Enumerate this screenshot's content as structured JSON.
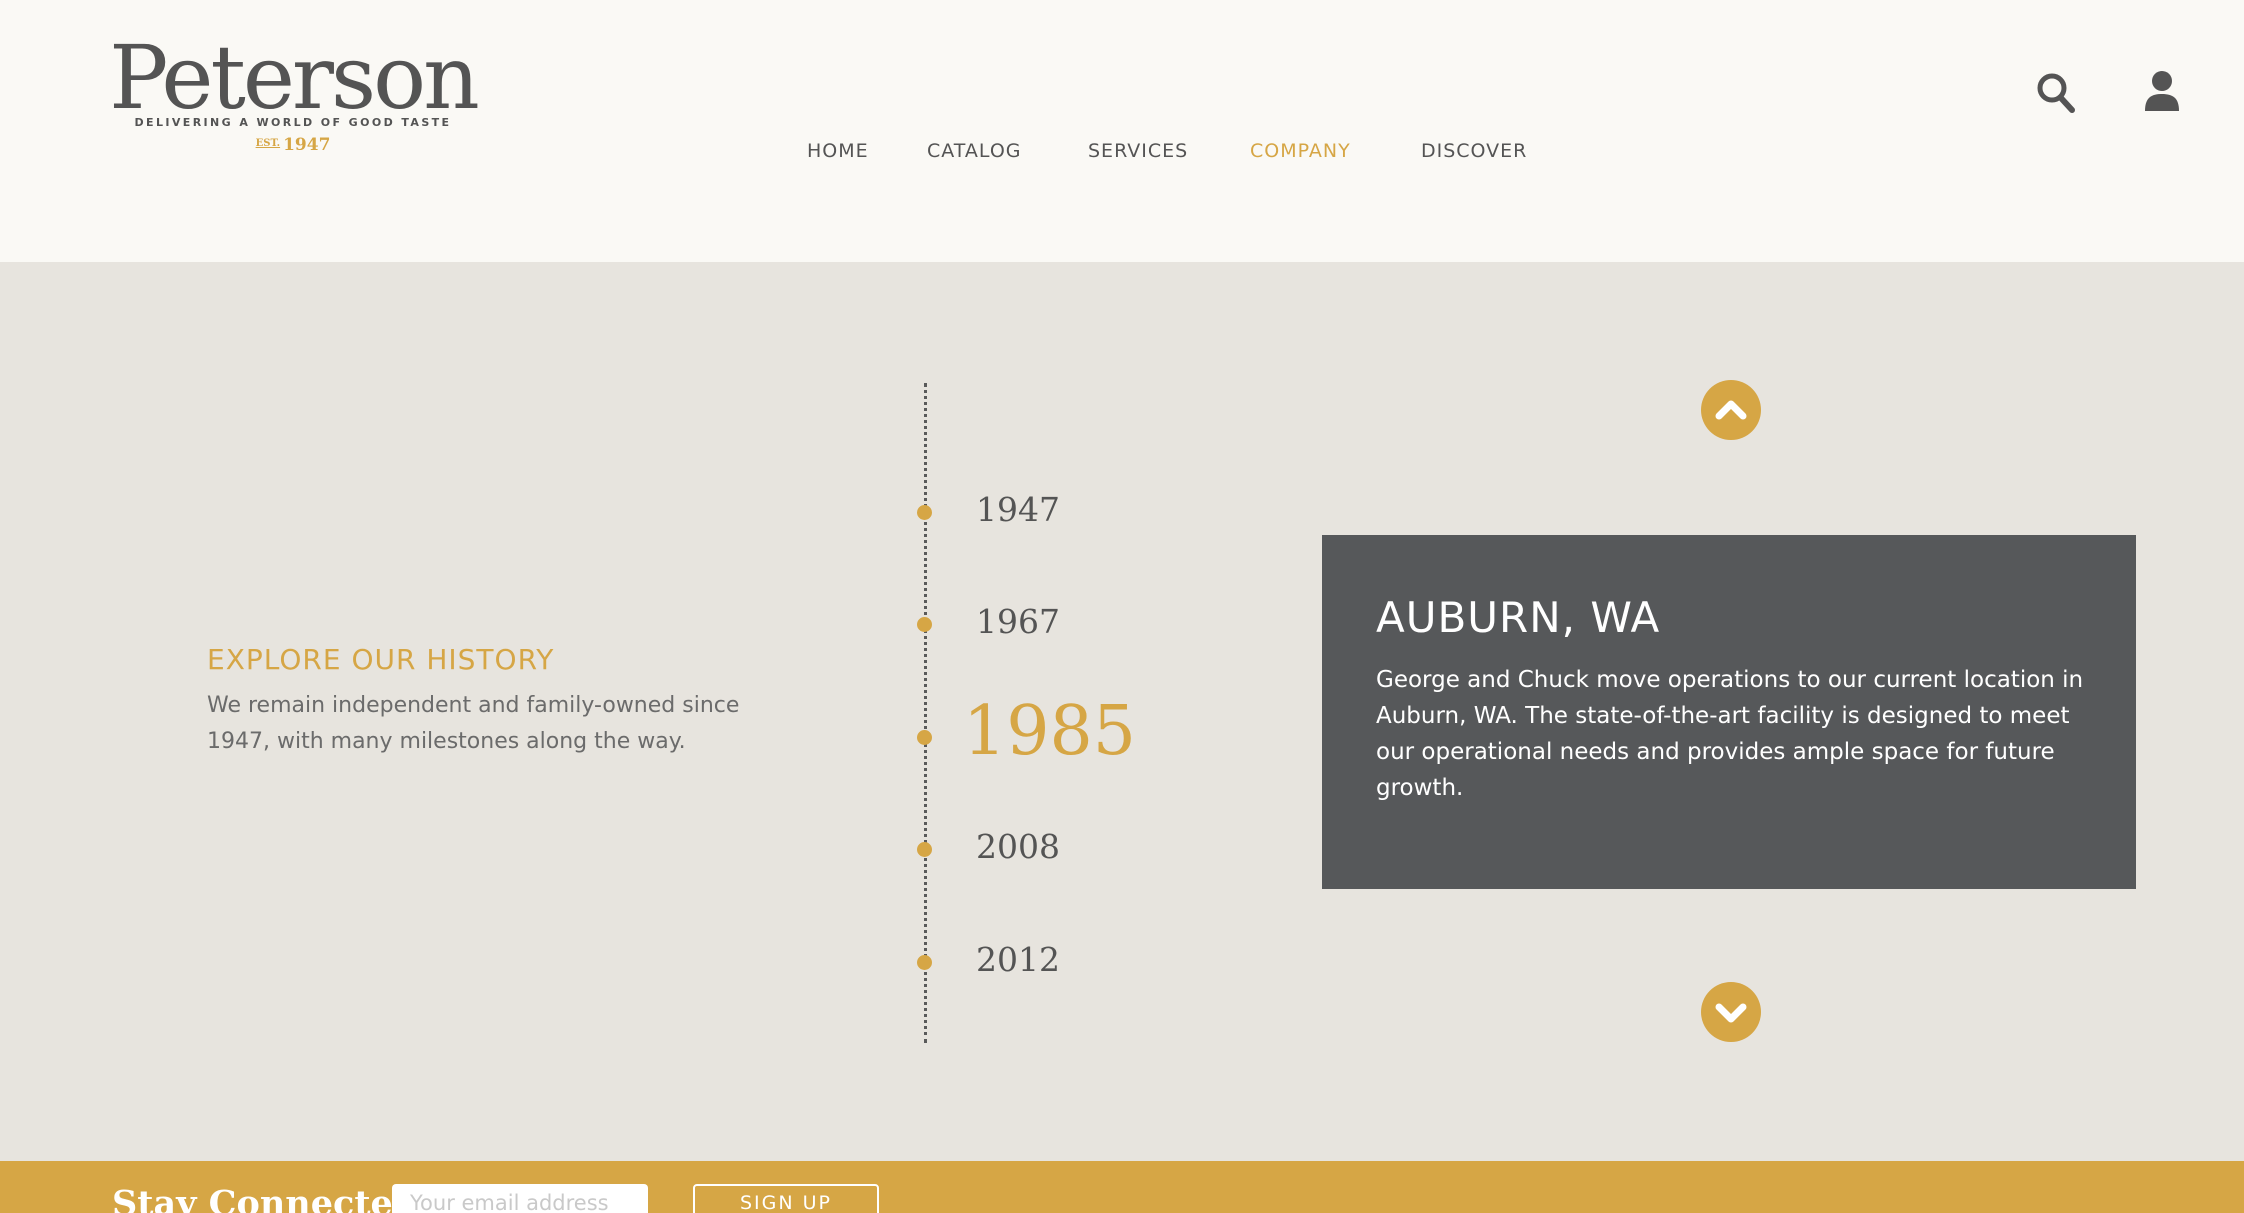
{
  "logo": {
    "name": "Peterson",
    "tagline": "DELIVERING A WORLD OF GOOD TASTE",
    "est_label": "EST.",
    "est_year": "1947"
  },
  "nav": {
    "items": [
      {
        "label": "HOME"
      },
      {
        "label": "CATALOG"
      },
      {
        "label": "SERVICES"
      },
      {
        "label": "COMPANY",
        "active": true
      },
      {
        "label": "DISCOVER"
      }
    ]
  },
  "header_icons": {
    "search": "search-icon",
    "account": "user-icon"
  },
  "history": {
    "eyebrow": "EXPLORE OUR HISTORY",
    "intro": "We remain independent and family-owned since 1947, with many milestones along the way."
  },
  "timeline": {
    "years": [
      "1947",
      "1967",
      "1985",
      "2008",
      "2012"
    ],
    "active_year": "1985",
    "prev_icon": "chevron-up-icon",
    "next_icon": "chevron-down-icon"
  },
  "card": {
    "title": "AUBURN, WA",
    "text": "George and Chuck move operations to our current location in Auburn, WA. The state-of-the-art facility is designed to meet our operational needs and provides ample space for future growth."
  },
  "newsletter": {
    "heading": "Stay Connected:",
    "placeholder": "Your email address",
    "button": "SIGN UP"
  },
  "colors": {
    "accent": "#d6a645",
    "card_bg": "#56585a",
    "page_bg": "#e7e4de",
    "header_bg": "#faf9f5",
    "text": "#545454"
  }
}
